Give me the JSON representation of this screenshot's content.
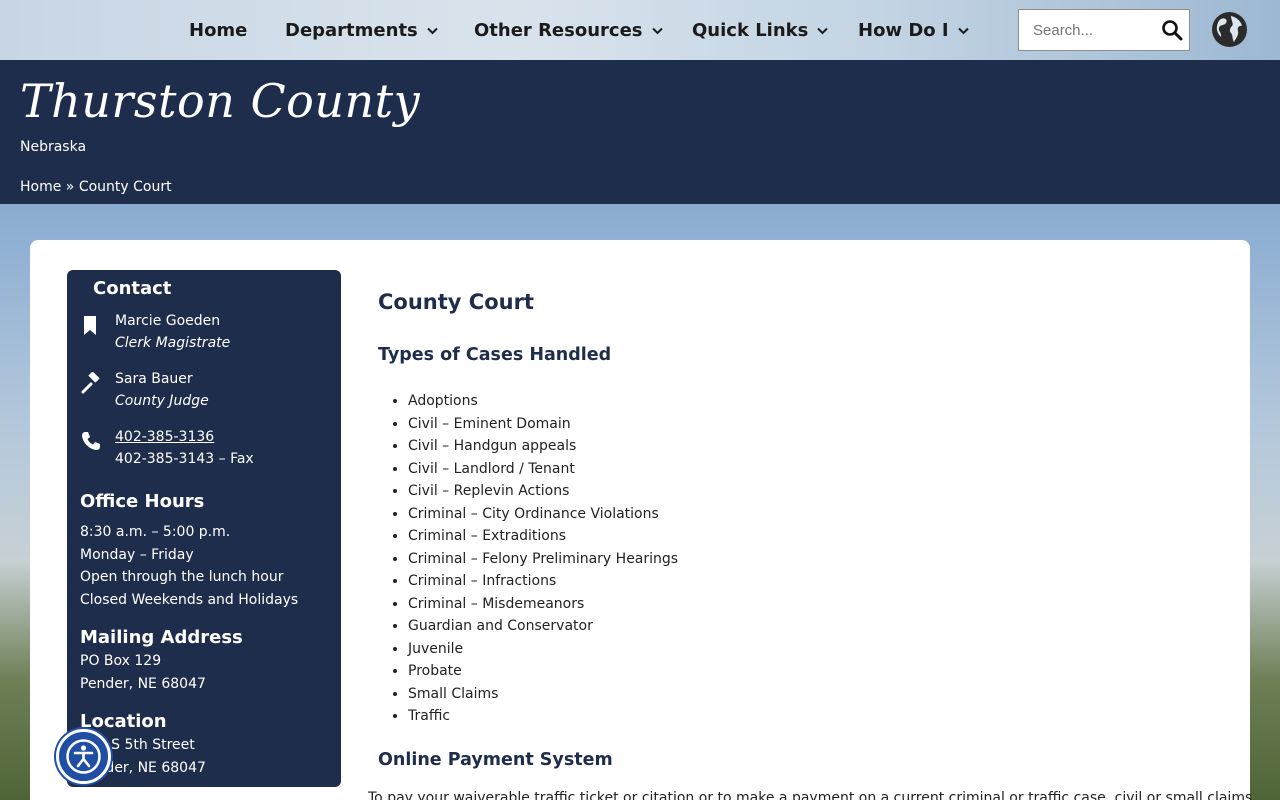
{
  "nav": {
    "items": [
      {
        "label": "Home",
        "has_dropdown": false
      },
      {
        "label": "Departments",
        "has_dropdown": true
      },
      {
        "label": "Other Resources",
        "has_dropdown": true
      },
      {
        "label": "Quick Links",
        "has_dropdown": true
      },
      {
        "label": "How Do I",
        "has_dropdown": true
      }
    ],
    "search_placeholder": "Search...",
    "search_icon": "magnifier",
    "language_icon": "globe"
  },
  "header": {
    "title": "Thurston County",
    "subtitle": "Nebraska",
    "breadcrumb": {
      "home": "Home",
      "separator": "»",
      "current": "County Court"
    }
  },
  "sidebar": {
    "contact_heading": "Contact",
    "contacts": [
      {
        "icon": "bookmark",
        "name": "Marcie Goeden",
        "role": "Clerk Magistrate"
      },
      {
        "icon": "gavel",
        "name": "Sara Bauer",
        "role": "County Judge"
      }
    ],
    "phone": {
      "icon": "phone",
      "number": "402-385-3136",
      "fax": "402-385-3143 – Fax"
    },
    "office_hours": {
      "heading": "Office Hours",
      "lines": [
        "8:30 a.m. – 5:00 p.m.",
        "Monday – Friday",
        "Open through the lunch hour",
        "Closed Weekends and Holidays"
      ]
    },
    "mailing": {
      "heading": "Mailing Address",
      "lines": [
        "PO Box 129",
        "Pender, NE 68047"
      ]
    },
    "location": {
      "heading": "Location",
      "lines": [
        "505 S 5th Street",
        "Pender, NE 68047"
      ]
    }
  },
  "main": {
    "title": "County Court",
    "cases_heading": "Types of Cases Handled",
    "cases": [
      "Adoptions",
      "Civil – Eminent Domain",
      "Civil – Handgun appeals",
      "Civil – Landlord / Tenant",
      "Civil – Replevin Actions",
      "Criminal – City Ordinance Violations",
      "Criminal – Extraditions",
      "Criminal – Felony Preliminary Hearings",
      "Criminal – Infractions",
      "Criminal – Misdemeanors",
      "Guardian and Conservator",
      "Juvenile",
      "Probate",
      "Small Claims",
      "Traffic"
    ],
    "payment_heading": "Online Payment System",
    "payment_text": "To pay your waiverable traffic ticket or citation or to make a payment on a current criminal or traffic case, civil or small claims"
  },
  "accessibility_button": {
    "icon": "accessibility"
  },
  "colors": {
    "navy": "#1f2d4c",
    "accessibility_blue": "#1f4ea3"
  }
}
